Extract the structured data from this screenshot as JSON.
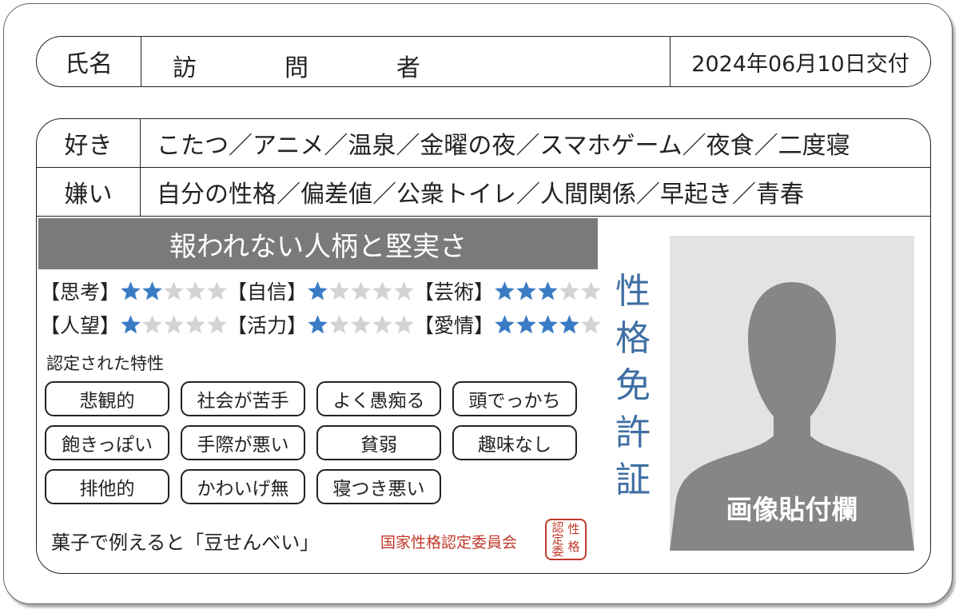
{
  "card": {
    "name_label": "氏名",
    "name_chars": [
      "訪",
      "問",
      "者"
    ],
    "issue_date": "2024年06月10日交付"
  },
  "likes": {
    "label": "好き",
    "value": "こたつ／アニメ／温泉／金曜の夜／スマホゲーム／夜食／二度寝"
  },
  "dislikes": {
    "label": "嫌い",
    "value": "自分の性格／偏差値／公衆トイレ／人間関係／早起き／青春"
  },
  "banner": "報われない人柄と堅実さ",
  "stats": [
    {
      "label": "【思考】",
      "rating": 2,
      "max": 5
    },
    {
      "label": "【自信】",
      "rating": 1,
      "max": 5
    },
    {
      "label": "【芸術】",
      "rating": 3,
      "max": 5
    },
    {
      "label": "【人望】",
      "rating": 1,
      "max": 5
    },
    {
      "label": "【活力】",
      "rating": 1,
      "max": 5
    },
    {
      "label": "【愛情】",
      "rating": 4,
      "max": 5
    }
  ],
  "traits_heading": "認定された特性",
  "traits": [
    "悲観的",
    "社会が苦手",
    "よく愚痴る",
    "頭でっかち",
    "飽きっぽい",
    "手際が悪い",
    "貧弱",
    "趣味なし",
    "排他的",
    "かわいげ無",
    "寝つき悪い"
  ],
  "snack": "菓子で例えると「豆せんべい」",
  "committee": "国家性格認定委員会",
  "seal_chars": [
    "性",
    "格",
    "認",
    "定",
    "委"
  ],
  "vertical_title": [
    "性",
    "格",
    "免",
    "許",
    "証"
  ],
  "photo_label": "画像貼付欄",
  "colors": {
    "star_filled": "#3a7cc4",
    "star_empty": "#d3d3d3",
    "title_blue": "#3f6fa3",
    "seal_red": "#c0392b",
    "banner_gray": "#7a7a7a",
    "silhouette": "#868686"
  },
  "icons": {
    "star": "star-icon",
    "person": "person-silhouette-icon"
  }
}
